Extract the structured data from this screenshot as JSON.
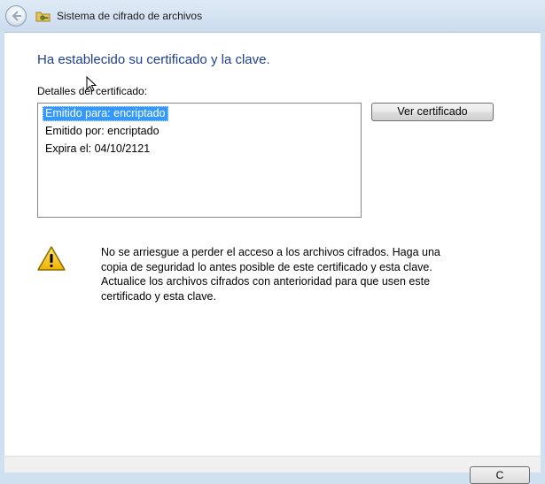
{
  "window": {
    "title": "Sistema de cifrado de archivos",
    "back_icon": "back-arrow-icon",
    "app_icon": "folder-key-icon"
  },
  "main": {
    "heading": "Ha establecido su certificado y la clave.",
    "details_label": "Detalles del certificado:",
    "certificate_details": [
      {
        "text": "Emitido para: encriptado",
        "selected": true
      },
      {
        "text": "Emitido por: encriptado",
        "selected": false
      },
      {
        "text": "Expira el: 04/10/2121",
        "selected": false
      }
    ],
    "view_certificate_button": "Ver certificado",
    "warning_icon": "warning-triangle-icon",
    "warning_lines": [
      "No se arriesgue a perder el acceso a los archivos cifrados. Haga una",
      "copia de seguridad lo antes posible de este certificado y esta clave.",
      "Actualice los archivos cifrados con anterioridad para que usen este",
      "certificado y esta clave."
    ]
  },
  "footer": {
    "partial_button_label": "C"
  },
  "colors": {
    "heading": "#1e3f8d",
    "selection": "#3399ff",
    "frame": "#cfe0f1"
  }
}
